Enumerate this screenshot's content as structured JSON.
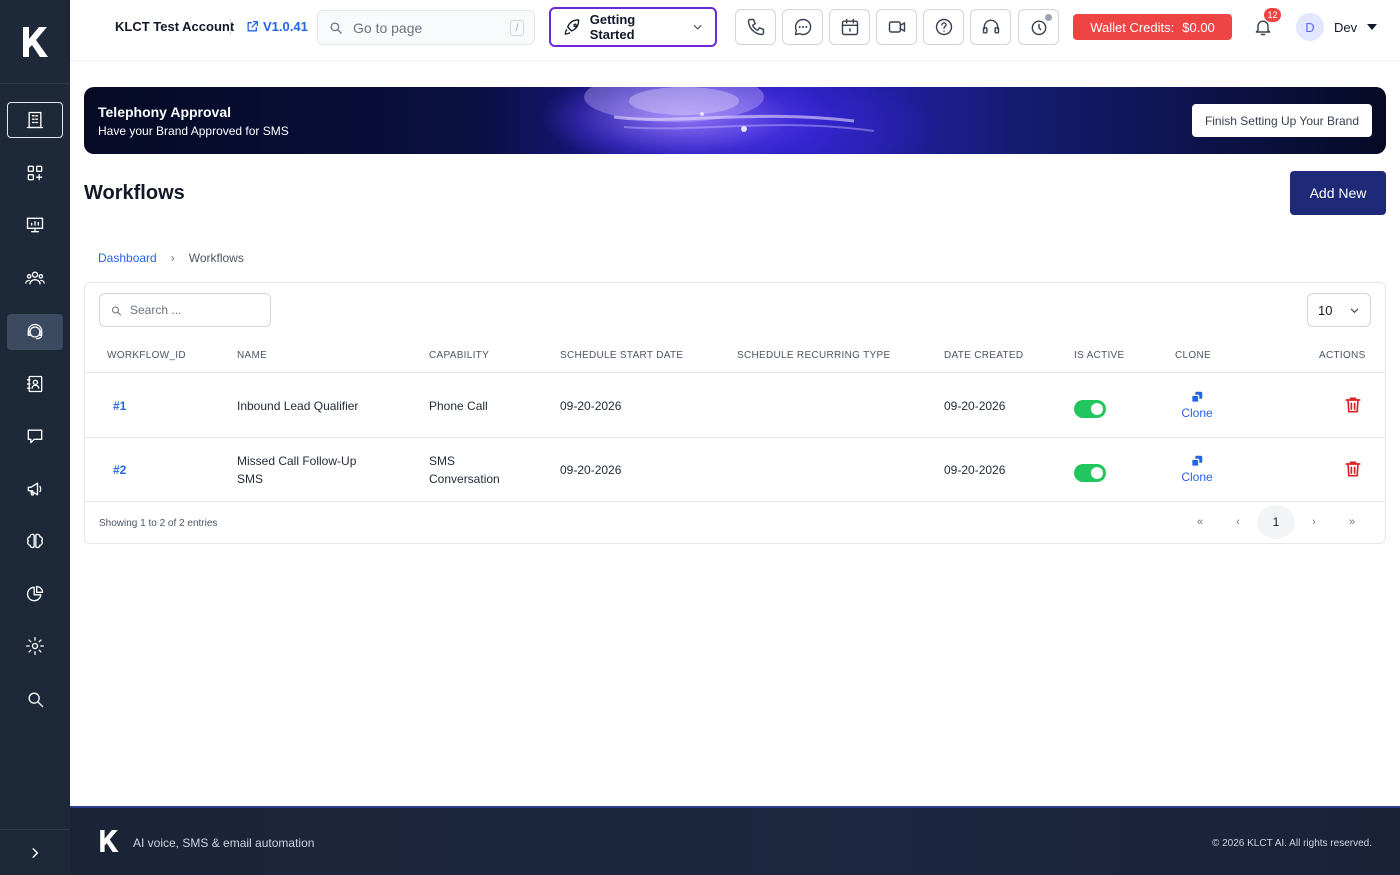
{
  "sidebar": {
    "logo": "K",
    "items": [
      {
        "name": "organization"
      },
      {
        "name": "apps"
      },
      {
        "name": "presentation"
      },
      {
        "name": "team"
      },
      {
        "name": "support-agent"
      },
      {
        "name": "contacts"
      },
      {
        "name": "chat"
      },
      {
        "name": "campaigns"
      },
      {
        "name": "ai-brain"
      },
      {
        "name": "analytics"
      },
      {
        "name": "settings"
      },
      {
        "name": "search"
      }
    ]
  },
  "topbar": {
    "account_name": "KLCT Test Account",
    "version": "V1.0.41",
    "goto_placeholder": "Go to page",
    "goto_shortcut": "/",
    "getting_started": "Getting Started",
    "wallet_label": "Wallet Credits:",
    "wallet_amount": "$0.00",
    "notification_count": "12",
    "user_initial": "D",
    "user_name": "Dev"
  },
  "banner": {
    "title": "Telephony Approval",
    "subtitle": "Have your Brand Approved for SMS",
    "cta": "Finish Setting Up Your Brand"
  },
  "page": {
    "title": "Workflows",
    "add_new": "Add New",
    "breadcrumb": {
      "home": "Dashboard",
      "separator": "›",
      "current": "Workflows"
    }
  },
  "table": {
    "search_placeholder": "Search ...",
    "page_size": "10",
    "columns": [
      "WORKFLOW_ID",
      "NAME",
      "CAPABILITY",
      "SCHEDULE START DATE",
      "SCHEDULE RECURRING TYPE",
      "DATE CREATED",
      "IS ACTIVE",
      "CLONE",
      "ACTIONS"
    ],
    "rows": [
      {
        "id": "#1",
        "name_line1": "Inbound Lead Qualifier",
        "name_line2": "",
        "cap_line1": "Phone Call",
        "cap_line2": "",
        "start": "09-20-2026",
        "recurring": "",
        "created": "09-20-2026",
        "active": true,
        "clone": "Clone"
      },
      {
        "id": "#2",
        "name_line1": "Missed Call Follow-Up",
        "name_line2": "SMS",
        "cap_line1": "SMS",
        "cap_line2": "Conversation",
        "start": "09-20-2026",
        "recurring": "",
        "created": "09-20-2026",
        "active": true,
        "clone": "Clone"
      }
    ],
    "info": "Showing 1 to 2 of 2 entries",
    "pagination": {
      "first": "«",
      "prev": "‹",
      "current": "1",
      "next": "›",
      "last": "»"
    }
  },
  "footer": {
    "logo": "K",
    "tagline": "AI voice, SMS & email automation",
    "copyright": "© 2026 KLCT AI. All rights reserved."
  },
  "colors": {
    "sidebar_bg": "#1d2838",
    "accent_primary": "#1e2a78",
    "link": "#2563eb",
    "wallet": "#ef4444",
    "active_toggle": "#22c55e",
    "delete": "#dc2626"
  }
}
